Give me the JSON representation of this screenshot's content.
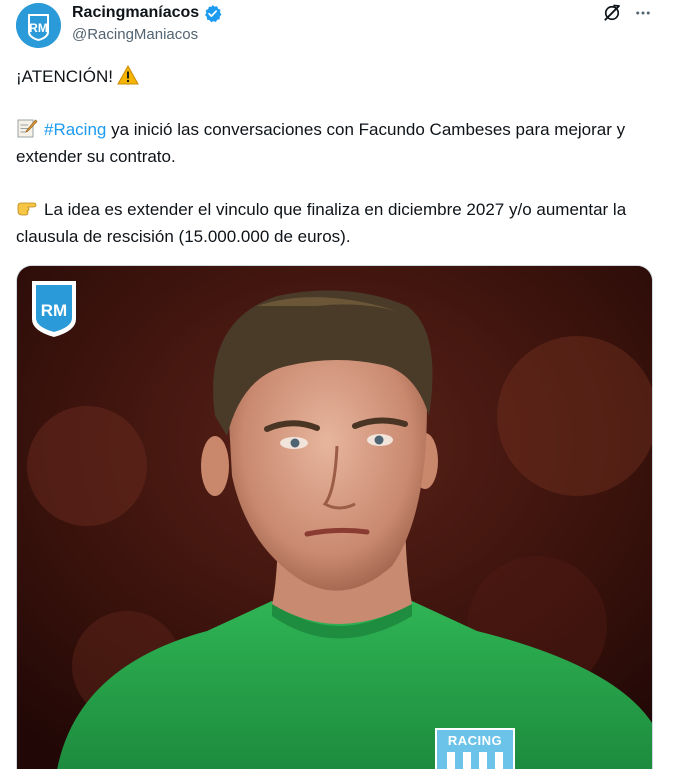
{
  "author": {
    "display_name": "Racingmaníacos",
    "handle": "@RacingManiacos",
    "verified": true,
    "avatar_initials": "RM",
    "avatar_color": "#2b9ad8"
  },
  "actions": {
    "grok_icon": "grok-icon",
    "more_icon": "more-dots-icon"
  },
  "tweet": {
    "line1_text": "¡ATENCIÓN!",
    "line1_emoji": "warning-icon",
    "line2_emoji": "memo-icon",
    "line2_hashtag": "#Racing",
    "line2_text": " ya inició las conversaciones con Facundo Cambeses para mejorar y extender su contrato.",
    "line3_emoji": "pointing-hand-icon",
    "line3_text": "La idea es extender el vinculo que finaliza en diciembre 2027 y/o aumentar la clausula de rescisión (15.000.000 de euros)."
  },
  "media": {
    "logo_text": "RM",
    "jersey_crest_text": "RACING",
    "accent_color": "#2aa84a",
    "link_color": "#1d9bf0"
  }
}
